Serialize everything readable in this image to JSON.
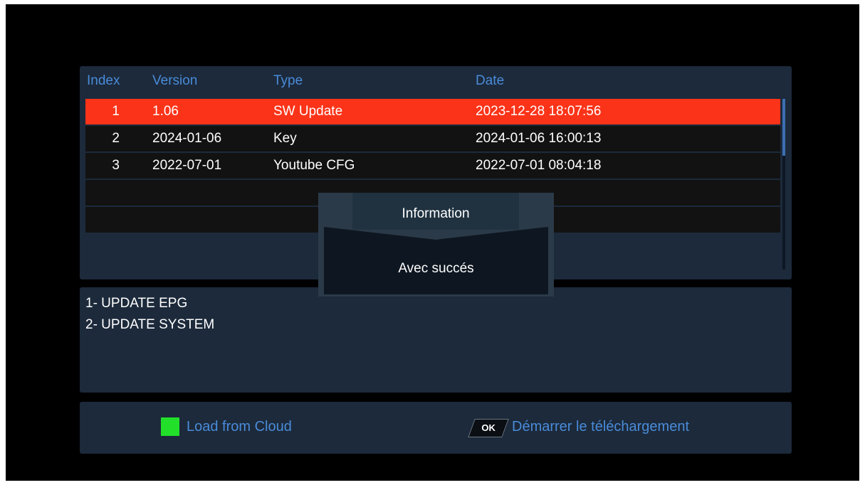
{
  "table": {
    "headers": {
      "index": "Index",
      "version": "Version",
      "type": "Type",
      "date": "Date"
    },
    "rows": [
      {
        "index": "1",
        "version": "1.06",
        "type": "SW Update",
        "date": "2023-12-28 18:07:56"
      },
      {
        "index": "2",
        "version": "2024-01-06",
        "type": "Key",
        "date": "2024-01-06 16:00:13"
      },
      {
        "index": "3",
        "version": "2022-07-01",
        "type": "Youtube CFG",
        "date": "2022-07-01 08:04:18"
      }
    ],
    "selected_index": 0
  },
  "info": {
    "lines": [
      "1- UPDATE EPG",
      "2- UPDATE SYSTEM"
    ]
  },
  "footer": {
    "green_key_label": "Load from Cloud",
    "ok_key_text": "OK",
    "ok_key_label": "Démarrer le téléchargement"
  },
  "dialog": {
    "title": "Information",
    "message": "Avec succés"
  },
  "colors": {
    "background": "#000000",
    "panel": "#1c2a3b",
    "selected_row": "#fb3318",
    "header_text": "#4a8bd9",
    "green_key": "#22e02a"
  },
  "icons": {
    "green_key": "green-color-key-icon",
    "ok_key": "ok-key-icon"
  }
}
